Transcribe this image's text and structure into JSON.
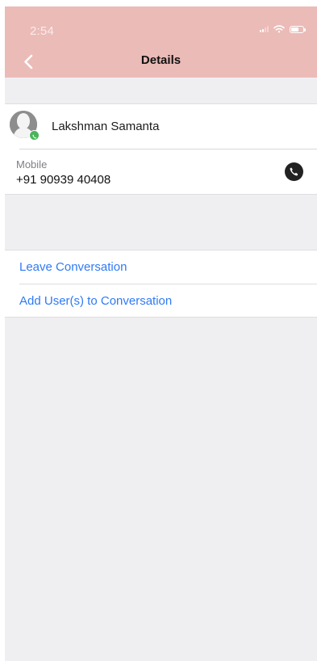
{
  "status_bar": {
    "time": "2:54",
    "signal_icon": "signal-icon",
    "wifi_icon": "wifi-icon",
    "battery_icon": "battery-icon"
  },
  "nav": {
    "back_icon": "chevron-left-icon",
    "title": "Details"
  },
  "contact": {
    "avatar_icon": "person-silhouette-icon",
    "badge_icon": "whatsapp-icon",
    "name": "Lakshman Samanta"
  },
  "phone": {
    "label": "Mobile",
    "number": "+91 90939 40408",
    "call_icon": "phone-icon"
  },
  "actions": [
    {
      "label": "Leave Conversation"
    },
    {
      "label": "Add User(s) to Conversation"
    }
  ],
  "colors": {
    "header_bg": "#ebbbb7",
    "link": "#2f7af6",
    "section_bg": "#efeff2",
    "badge": "#4ab55a"
  }
}
